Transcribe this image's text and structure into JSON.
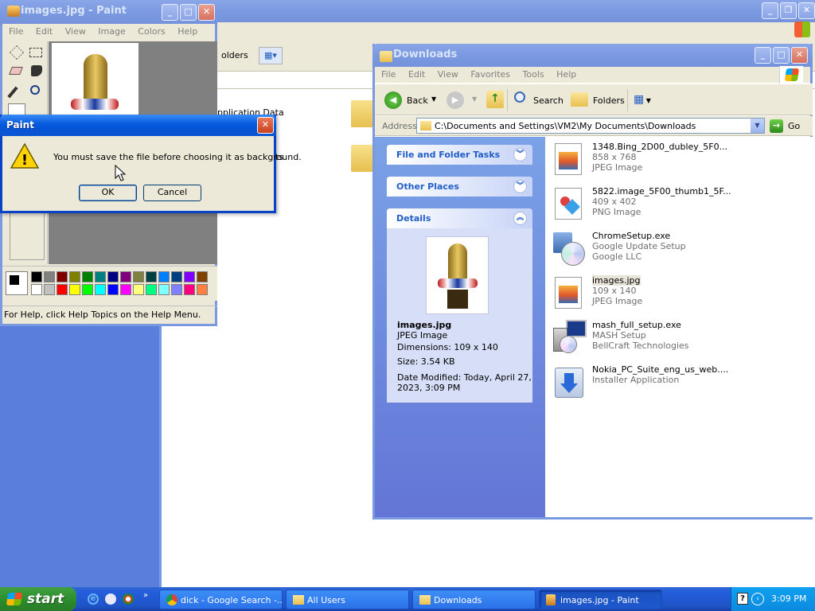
{
  "desktop": {
    "color": "#5a7edc"
  },
  "background_window": {
    "toolbar": {
      "folders_label": "olders"
    },
    "items": [
      "pplication Data",
      "ts"
    ]
  },
  "paint": {
    "title": "images.jpg - Paint",
    "menu": [
      "File",
      "Edit",
      "View",
      "Image",
      "Colors",
      "Help"
    ],
    "status": "For Help, click Help Topics on the Help Menu.",
    "palette": [
      "#000000",
      "#808080",
      "#800000",
      "#808000",
      "#008000",
      "#008080",
      "#000080",
      "#800080",
      "#808040",
      "#004040",
      "#0080ff",
      "#004080",
      "#8000ff",
      "#804000",
      "#ffffff",
      "#c0c0c0",
      "#ff0000",
      "#ffff00",
      "#00ff00",
      "#00ffff",
      "#0000ff",
      "#ff00ff",
      "#ffff80",
      "#00ff80",
      "#80ffff",
      "#8080ff",
      "#ff0080",
      "#ff8040"
    ]
  },
  "dialog": {
    "title": "Paint",
    "message": "You must save the file before choosing it as background.",
    "ok": "OK",
    "cancel": "Cancel"
  },
  "explorer": {
    "title": "Downloads",
    "menu": [
      "File",
      "Edit",
      "View",
      "Favorites",
      "Tools",
      "Help"
    ],
    "toolbar": {
      "back": "Back",
      "search": "Search",
      "folders": "Folders"
    },
    "address_label": "Address",
    "address_value": "C:\\Documents and Settings\\VM2\\My Documents\\Downloads",
    "go": "Go",
    "panels": {
      "tasks": "File and Folder Tasks",
      "places": "Other Places",
      "details": "Details"
    },
    "details": {
      "name": "images.jpg",
      "type": "JPEG Image",
      "dimensions": "Dimensions: 109 x 140",
      "size": "Size: 3.54 KB",
      "modified_1": "Date Modified: Today, April 27,",
      "modified_2": "2023, 3:09 PM"
    },
    "files": [
      {
        "name": "1348.Bing_2D00_dubley_5F0...",
        "line2": "858 x 768",
        "line3": "JPEG Image",
        "icon": "jpeg-icon"
      },
      {
        "name": "5822.image_5F00_thumb1_5F...",
        "line2": "409 x 402",
        "line3": "PNG Image",
        "icon": "png-icon"
      },
      {
        "name": "ChromeSetup.exe",
        "line2": "Google Update Setup",
        "line3": "Google LLC",
        "icon": "installer-cd-icon"
      },
      {
        "name": "images.jpg",
        "line2": "109 x 140",
        "line3": "JPEG Image",
        "icon": "jpeg-icon"
      },
      {
        "name": "mash_full_setup.exe",
        "line2": "MASH Setup",
        "line3": "BellCraft Technologies",
        "icon": "setup-computer-icon"
      },
      {
        "name": "Nokia_PC_Suite_eng_us_web....",
        "line2": "Installer Application",
        "line3": "",
        "icon": "download-arrow-icon"
      }
    ]
  },
  "taskbar": {
    "start": "start",
    "tasks": [
      "dick - Google Search -...",
      "All Users",
      "Downloads",
      "images.jpg - Paint"
    ],
    "clock": "3:09 PM"
  }
}
